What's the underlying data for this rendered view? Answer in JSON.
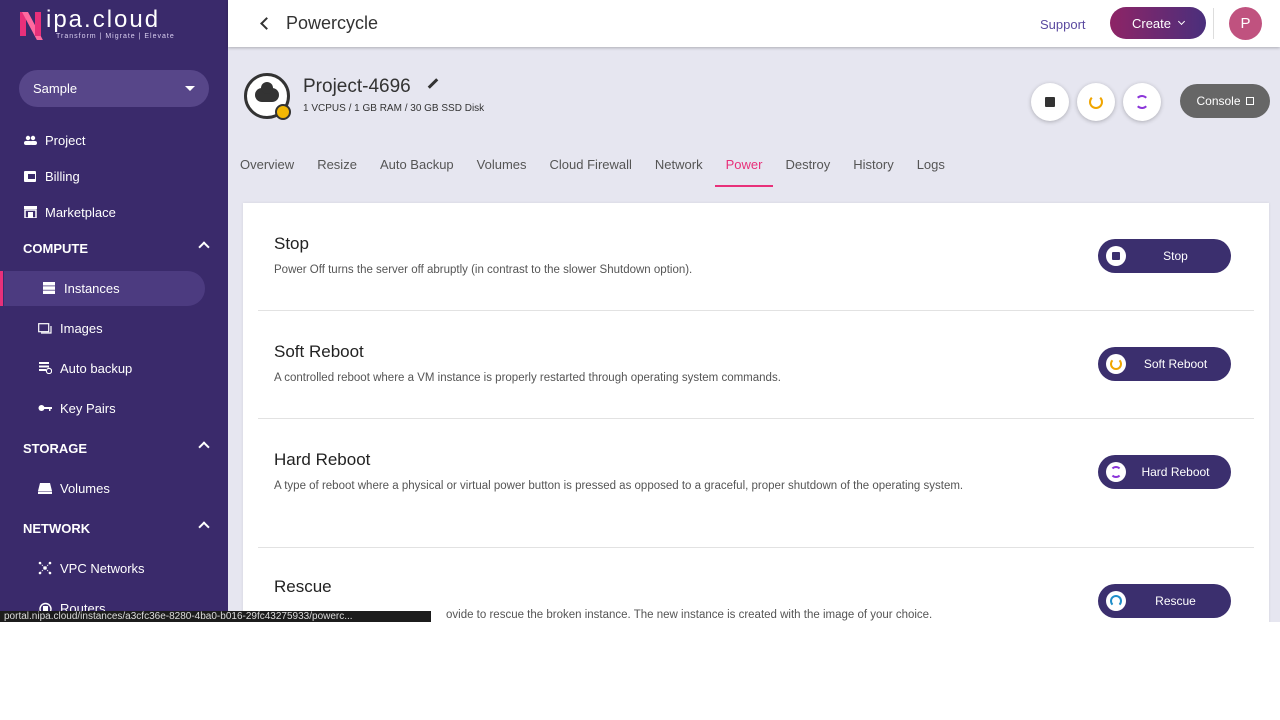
{
  "brand": {
    "name": "nipa.cloud",
    "name_rest": "ipa.cloud",
    "tagline": "Transform | Migrate | Elevate"
  },
  "sidebar": {
    "project_select": "Sample",
    "items": [
      {
        "label": "Project",
        "icon": "group-icon"
      },
      {
        "label": "Billing",
        "icon": "billing-icon"
      },
      {
        "label": "Marketplace",
        "icon": "store-icon"
      }
    ],
    "sections": [
      {
        "label": "COMPUTE",
        "items": [
          {
            "label": "Instances",
            "icon": "server-icon",
            "active": true
          },
          {
            "label": "Images",
            "icon": "image-icon"
          },
          {
            "label": "Auto backup",
            "icon": "backup-icon"
          },
          {
            "label": "Key Pairs",
            "icon": "key-icon"
          }
        ]
      },
      {
        "label": "STORAGE",
        "items": [
          {
            "label": "Volumes",
            "icon": "drive-icon"
          }
        ]
      },
      {
        "label": "NETWORK",
        "items": [
          {
            "label": "VPC Networks",
            "icon": "network-icon"
          },
          {
            "label": "Routers",
            "icon": "router-icon"
          }
        ]
      }
    ]
  },
  "topbar": {
    "title": "Powercycle",
    "support": "Support",
    "create": "Create",
    "avatar_initial": "P"
  },
  "instance": {
    "name": "Project-4696",
    "spec": "1 VCPUS / 1 GB RAM / 30 GB SSD Disk",
    "console_label": "Console",
    "status_color": "#f2b705"
  },
  "tabs": [
    "Overview",
    "Resize",
    "Auto Backup",
    "Volumes",
    "Cloud Firewall",
    "Network",
    "Power",
    "Destroy",
    "History",
    "Logs"
  ],
  "active_tab": "Power",
  "power_actions": [
    {
      "title": "Stop",
      "desc": "Power Off turns the server off abruptly (in contrast to the slower Shutdown option).",
      "button": "Stop",
      "icon": "stop-icon"
    },
    {
      "title": "Soft Reboot",
      "desc": "A controlled reboot where a VM instance is properly restarted through operating system commands.",
      "button": "Soft Reboot",
      "icon": "soft-reboot-icon"
    },
    {
      "title": "Hard Reboot",
      "desc": "A type of reboot where a physical or virtual power button is pressed as opposed to a graceful, proper shutdown of the operating system.",
      "button": "Hard Reboot",
      "icon": "hard-reboot-icon"
    },
    {
      "title": "Rescue",
      "desc": "ovide to rescue the broken instance. The new instance is created with the image of your choice.",
      "button": "Rescue",
      "icon": "rescue-icon"
    }
  ],
  "status_url": "portal.nipa.cloud/instances/a3cfc36e-8280-4ba0-b016-29fc43275933/powerc...",
  "colors": {
    "sidebar": "#3a2a6b",
    "accent": "#e8307a",
    "button": "#3b2f6e"
  }
}
